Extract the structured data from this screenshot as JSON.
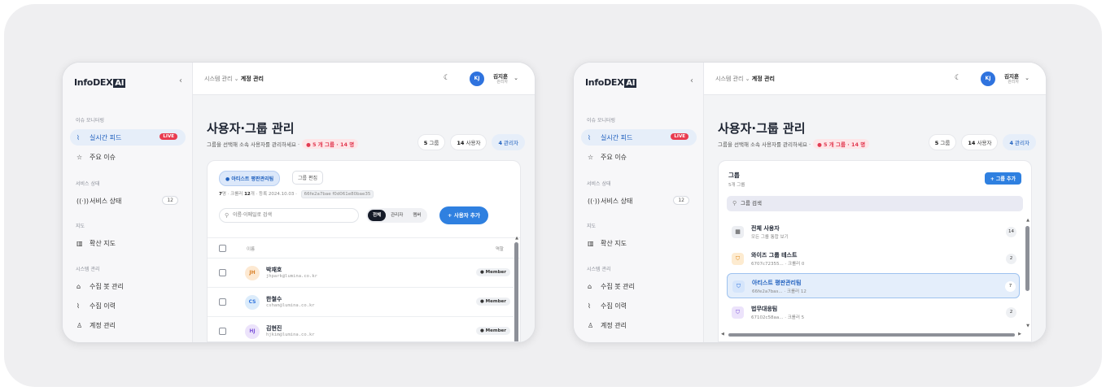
{
  "app": {
    "logo_text": "InfoDEX",
    "logo_ai": "AI"
  },
  "sidebar": {
    "collapse_icon": "chevron-left-icon",
    "sections": [
      {
        "title": "이슈 모니터링",
        "items": [
          {
            "label": "실시간 피드",
            "icon": "activity-icon",
            "badge": "LIVE",
            "active": true
          },
          {
            "label": "주요 이슈",
            "icon": "star-icon"
          }
        ]
      },
      {
        "title": "서비스 상태",
        "items": [
          {
            "label": "서비스 상태",
            "icon": "broadcast-icon",
            "count": "12"
          }
        ]
      },
      {
        "title": "지도",
        "items": [
          {
            "label": "확산 지도",
            "icon": "map-icon"
          }
        ]
      },
      {
        "title": "시스템 관리",
        "items": [
          {
            "label": "수집 봇 관리",
            "icon": "bot-icon"
          },
          {
            "label": "수집 이력",
            "icon": "activity-icon"
          },
          {
            "label": "계정 관리",
            "icon": "user-icon"
          }
        ]
      }
    ]
  },
  "topbar": {
    "breadcrumb_parent": "시스템 관리",
    "breadcrumb_sep": "⌄",
    "breadcrumb_current": "계정 관리",
    "theme_icon": "moon-icon",
    "user_initials": "KJ",
    "user_name": "김지훈",
    "user_role": "관리자"
  },
  "page": {
    "title": "사용자·그룹 관리",
    "subtitle": "그룹을 선택해 소속 사용자를 관리하세요 ·",
    "summary_pill": "● 5 개 그룹 · 14 명",
    "stats": [
      {
        "value": "5",
        "label": "그룹"
      },
      {
        "value": "14",
        "label": "사용자"
      },
      {
        "value": "4",
        "label": "관리자",
        "accent": true
      }
    ]
  },
  "group_detail": {
    "chip": "● 아티스트 평판관리팀",
    "edit_label": "그룹 편집",
    "members_value": "7",
    "members_unit": "명",
    "crawler_label": "크롤러",
    "crawler_value": "12",
    "crawler_unit": "개",
    "created_label": "등록 2024.10.03",
    "group_id": "66fe2a7bae f0d061e80bae35",
    "search_placeholder": "이름·이메일로 검색",
    "filters": [
      "전체",
      "관리자",
      "멤버"
    ],
    "active_filter": 0,
    "add_user_label": "+  사용자 추가",
    "col_name": "이름",
    "col_role": "역할",
    "rows": [
      {
        "initials": "JH",
        "name": "박재호",
        "email": "jhpark@lumina.co.kr",
        "role": "● Member",
        "bg": "#fde9d2",
        "fg": "#d9822b"
      },
      {
        "initials": "CS",
        "name": "한철수",
        "email": "cshan@lumina.co.kr",
        "role": "● Member",
        "bg": "#dcecfb",
        "fg": "#2f73de"
      },
      {
        "initials": "HJ",
        "name": "김현진",
        "email": "hjkim@lumina.co.kr",
        "role": "● Member",
        "bg": "#ece3fb",
        "fg": "#7e56d9"
      }
    ]
  },
  "group_list": {
    "title": "그룹",
    "subtitle": "5개 그룹",
    "add_label": "+ 그룹 추가",
    "search_value": "그룹 검색",
    "groups": [
      {
        "name": "전체 사용자",
        "meta": "모든 그룹 통합 보기",
        "count": "14",
        "icon": "grid-icon",
        "bg": "#eceef2",
        "fg": "#444"
      },
      {
        "name": "와이즈 그룹 테스트",
        "meta": "6707c72355... · 크롤러 0",
        "count": "2",
        "icon": "shield-icon",
        "bg": "#fdebd0",
        "fg": "#e08a1e"
      },
      {
        "name": "아티스트 평판관리팀",
        "meta": "66fe2a7bas... · 크롤러 12",
        "count": "7",
        "icon": "shield-icon",
        "bg": "#d5e5fb",
        "fg": "#2f73de",
        "selected": true
      },
      {
        "name": "법무대응팀",
        "meta": "67102c58aa... · 크롤러 5",
        "count": "2",
        "icon": "shield-icon",
        "bg": "#ece3fb",
        "fg": "#7e56d9"
      }
    ]
  },
  "colors": {
    "accent": "#2f80e0",
    "live": "#e93b4f",
    "sidebar_bg": "#f7f7f9"
  }
}
